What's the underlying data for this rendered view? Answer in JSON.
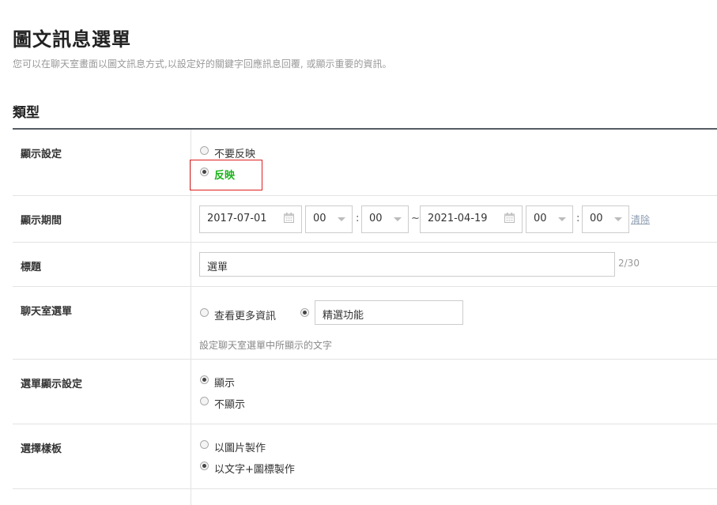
{
  "header": {
    "title": "圖文訊息選單",
    "description": "您可以在聊天室畫面以圖文訊息方式,以設定好的關鍵字回應訊息回覆, 或顯示重要的資訊。"
  },
  "section": {
    "title": "類型"
  },
  "rows": {
    "display": {
      "label": "顯示設定",
      "opt_hide": "不要反映",
      "opt_show": "反映",
      "selected": "反映",
      "highlight_color": "#e02020",
      "active_color": "#19b319"
    },
    "period": {
      "label": "顯示期間",
      "start_date": "2017-07-01",
      "start_hour": "00",
      "start_min": "00",
      "tilde": "~",
      "end_date": "2021-04-19",
      "end_hour": "00",
      "end_min": "00",
      "colon": ":",
      "clear": "清除"
    },
    "title": {
      "label": "標題",
      "value": "選單",
      "counter": "2/30"
    },
    "chat_menu": {
      "label": "聊天室選單",
      "opt_more": "查看更多資訊",
      "custom_value": "精選功能",
      "hint": "設定聊天室選單中所顯示的文字"
    },
    "menu_display": {
      "label": "選單顯示設定",
      "opt_show": "顯示",
      "opt_hide": "不顯示"
    },
    "template": {
      "label": "選擇樣板",
      "opt_image": "以圖片製作",
      "opt_text": "以文字+圖標製作"
    }
  }
}
